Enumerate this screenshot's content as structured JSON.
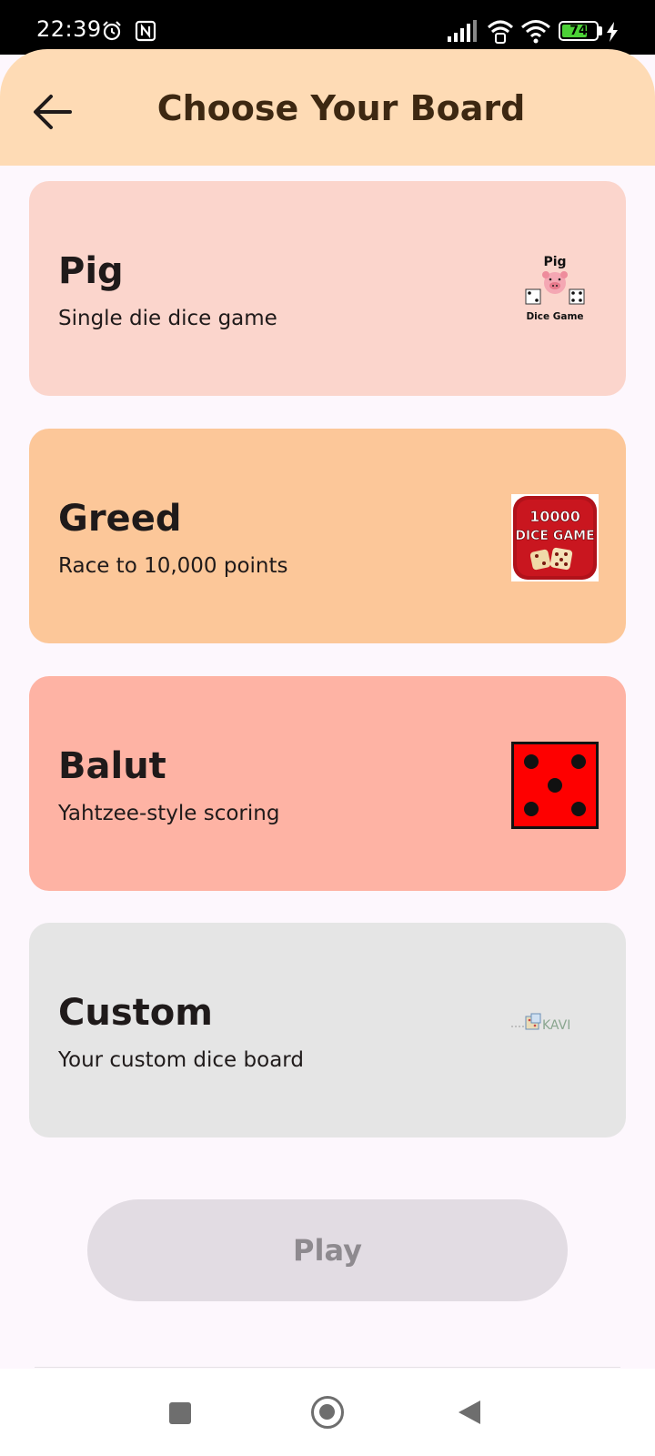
{
  "status_bar": {
    "time": "22:39",
    "battery_level": "74",
    "icons": [
      "alarm-icon",
      "nfc-icon",
      "signal-icon",
      "wifi-calling-icon",
      "wifi-icon",
      "battery-icon",
      "charging-bolt-icon"
    ]
  },
  "header": {
    "title": "Choose Your Board",
    "back_icon": "back-arrow-icon"
  },
  "boards": [
    {
      "title": "Pig",
      "description": "Single die dice game",
      "color": "#fbd5cc",
      "thumb_title": "Pig",
      "thumb_caption": "Dice Game"
    },
    {
      "title": "Greed",
      "description": "Race to 10,000 points",
      "color": "#fcc799",
      "thumb_line1": "10000",
      "thumb_line2": "DICE GAME"
    },
    {
      "title": "Balut",
      "description": "Yahtzee-style scoring",
      "color": "#feb3a4"
    },
    {
      "title": "Custom",
      "description": "Your custom dice board",
      "color": "#e5e5e5",
      "thumb_label": "KAVI"
    }
  ],
  "play_button": {
    "label": "Play"
  },
  "colors": {
    "header_bg": "#fedbb5",
    "page_bg": "#fdf7fd",
    "play_disabled_bg": "#e2dce3",
    "play_disabled_text": "#8e8a8f"
  }
}
